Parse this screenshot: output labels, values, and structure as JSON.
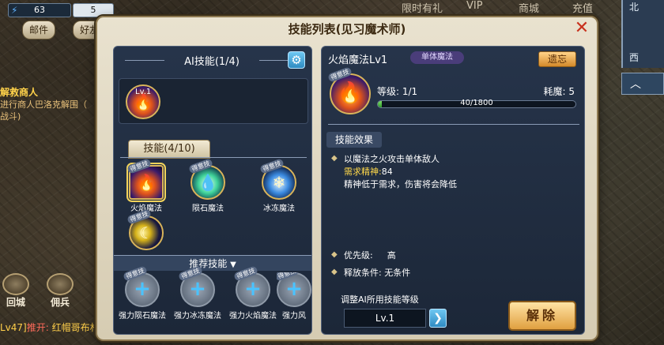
{
  "hud": {
    "power": "63",
    "level": "5",
    "top_links": [
      "限时有礼",
      "VIP",
      "商城",
      "充值"
    ],
    "buttons": [
      "邮件",
      "好友"
    ],
    "quest": {
      "title": "解救商人",
      "desc_line1": "进行商人巴洛克解围（",
      "desc_line2": "战斗)"
    },
    "bottom_icons": [
      "回城",
      "佣兵"
    ],
    "chat": {
      "prefix": "Lv47]",
      "name": "推开:",
      "text": "红帽哥布林"
    },
    "minimap": {
      "north": "北",
      "west": "西"
    }
  },
  "dialog": {
    "title": "技能列表(见习魔术师)",
    "close": "✕",
    "ai_header": "AI技能(1/4)",
    "ai_slot_level": "Lv.1",
    "skills_tab": "技能(4/10)",
    "skills": [
      {
        "label": "火焰魔法",
        "badge": "得意技"
      },
      {
        "label": "陨石魔法",
        "badge": "得意技"
      },
      {
        "label": "冰冻魔法",
        "badge": "得意技"
      },
      {
        "label": "",
        "badge": "得意技"
      }
    ],
    "recommend_header": "推荐技能",
    "recommend": [
      {
        "label": "强力陨石魔法",
        "badge": "得意技"
      },
      {
        "label": "强力冰冻魔法",
        "badge": "得意技"
      },
      {
        "label": "强力火焰魔法",
        "badge": "得意技"
      },
      {
        "label": "强力风",
        "badge": "得意技"
      }
    ],
    "detail": {
      "name": "火焰魔法Lv1",
      "type": "单体魔法",
      "forget": "遗忘",
      "big_badge": "得意技",
      "level": "等级: 1/1",
      "mana": "耗魔: 5",
      "exp_text": "40/1800",
      "exp_fraction": 0.022,
      "effect_tab": "技能效果",
      "effect_line1": "以魔法之火攻击单体敌人",
      "effect_req_label": "需求精神:",
      "effect_req_value": "84",
      "effect_line3": "精神低于需求，伤害将会降低",
      "priority_label": "优先级:",
      "priority_value": "高",
      "condition": "释放条件: 无条件",
      "adjust_label": "调整AI所用技能等级",
      "adjust_value": "Lv.1",
      "remove": "解除"
    }
  }
}
